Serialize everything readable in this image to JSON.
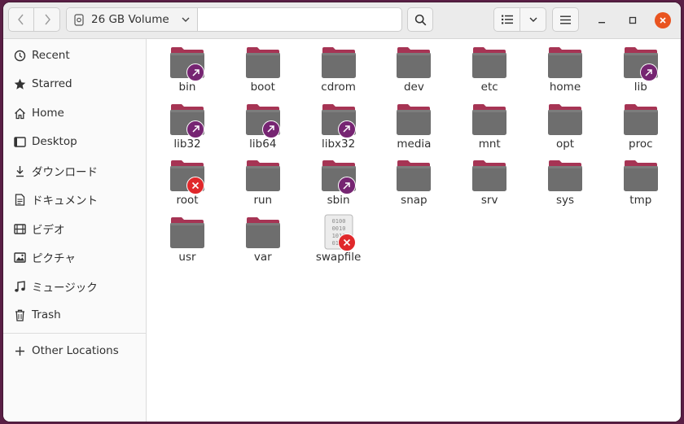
{
  "header": {
    "location_label": "26 GB Volume"
  },
  "sidebar": {
    "items": [
      {
        "label": "Recent",
        "icon": "clock-icon"
      },
      {
        "label": "Starred",
        "icon": "star-icon"
      },
      {
        "label": "Home",
        "icon": "home-icon"
      },
      {
        "label": "Desktop",
        "icon": "desktop-icon"
      },
      {
        "label": "ダウンロード",
        "icon": "download-icon"
      },
      {
        "label": "ドキュメント",
        "icon": "document-icon"
      },
      {
        "label": "ビデオ",
        "icon": "video-icon"
      },
      {
        "label": "ピクチャ",
        "icon": "picture-icon"
      },
      {
        "label": "ミュージック",
        "icon": "music-icon"
      },
      {
        "label": "Trash",
        "icon": "trash-icon"
      }
    ],
    "other_locations": {
      "label": "Other Locations",
      "icon": "plus-icon"
    }
  },
  "files": [
    {
      "name": "bin",
      "kind": "folder",
      "emblem": "symlink"
    },
    {
      "name": "boot",
      "kind": "folder",
      "emblem": ""
    },
    {
      "name": "cdrom",
      "kind": "folder",
      "emblem": ""
    },
    {
      "name": "dev",
      "kind": "folder",
      "emblem": ""
    },
    {
      "name": "etc",
      "kind": "folder",
      "emblem": ""
    },
    {
      "name": "home",
      "kind": "folder",
      "emblem": ""
    },
    {
      "name": "lib",
      "kind": "folder",
      "emblem": "symlink"
    },
    {
      "name": "lib32",
      "kind": "folder",
      "emblem": "symlink"
    },
    {
      "name": "lib64",
      "kind": "folder",
      "emblem": "symlink"
    },
    {
      "name": "libx32",
      "kind": "folder",
      "emblem": "symlink"
    },
    {
      "name": "media",
      "kind": "folder",
      "emblem": ""
    },
    {
      "name": "mnt",
      "kind": "folder",
      "emblem": ""
    },
    {
      "name": "opt",
      "kind": "folder",
      "emblem": ""
    },
    {
      "name": "proc",
      "kind": "folder",
      "emblem": ""
    },
    {
      "name": "root",
      "kind": "folder",
      "emblem": "no-access"
    },
    {
      "name": "run",
      "kind": "folder",
      "emblem": ""
    },
    {
      "name": "sbin",
      "kind": "folder",
      "emblem": "symlink"
    },
    {
      "name": "snap",
      "kind": "folder",
      "emblem": ""
    },
    {
      "name": "srv",
      "kind": "folder",
      "emblem": ""
    },
    {
      "name": "sys",
      "kind": "folder",
      "emblem": ""
    },
    {
      "name": "tmp",
      "kind": "folder",
      "emblem": ""
    },
    {
      "name": "usr",
      "kind": "folder",
      "emblem": ""
    },
    {
      "name": "var",
      "kind": "folder",
      "emblem": ""
    },
    {
      "name": "swapfile",
      "kind": "binary-file",
      "emblem": "no-access"
    }
  ],
  "colors": {
    "accent": "#e95420",
    "folder_body": "#6e6e6e",
    "folder_tab": "#a63454",
    "symlink_emblem": "#762572",
    "no_access_emblem": "#e0282b"
  }
}
